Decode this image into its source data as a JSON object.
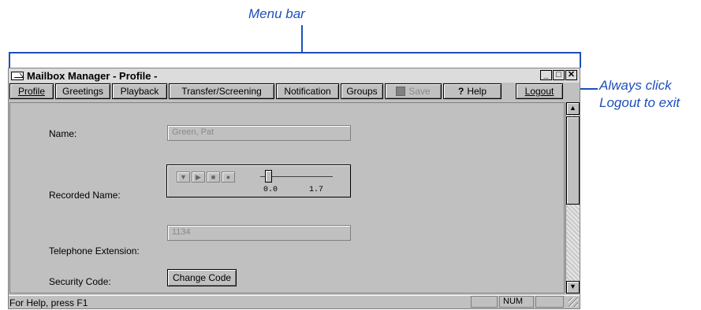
{
  "callouts": {
    "menu_bar": "Menu bar",
    "logout_note_line1": "Always click",
    "logout_note_line2": "Logout to exit"
  },
  "window": {
    "title": "Mailbox Manager - Profile -",
    "controls": [
      "_",
      "□",
      "✕"
    ]
  },
  "menu": {
    "items": [
      "Profile",
      "Greetings",
      "Playback",
      "Transfer/Screening",
      "Notification",
      "Groups",
      "Save",
      "Help",
      "Logout"
    ]
  },
  "form": {
    "name_label": "Name:",
    "name_value": "Green, Pat",
    "recorded_name_label": "Recorded Name:",
    "player_start": "0.0",
    "player_end": "1.7",
    "extension_label": "Telephone Extension:",
    "extension_value": "1134",
    "security_label": "Security Code:",
    "change_code_button": "Change Code"
  },
  "status": {
    "help_text": "For Help, press F1",
    "num_indicator": "NUM"
  }
}
